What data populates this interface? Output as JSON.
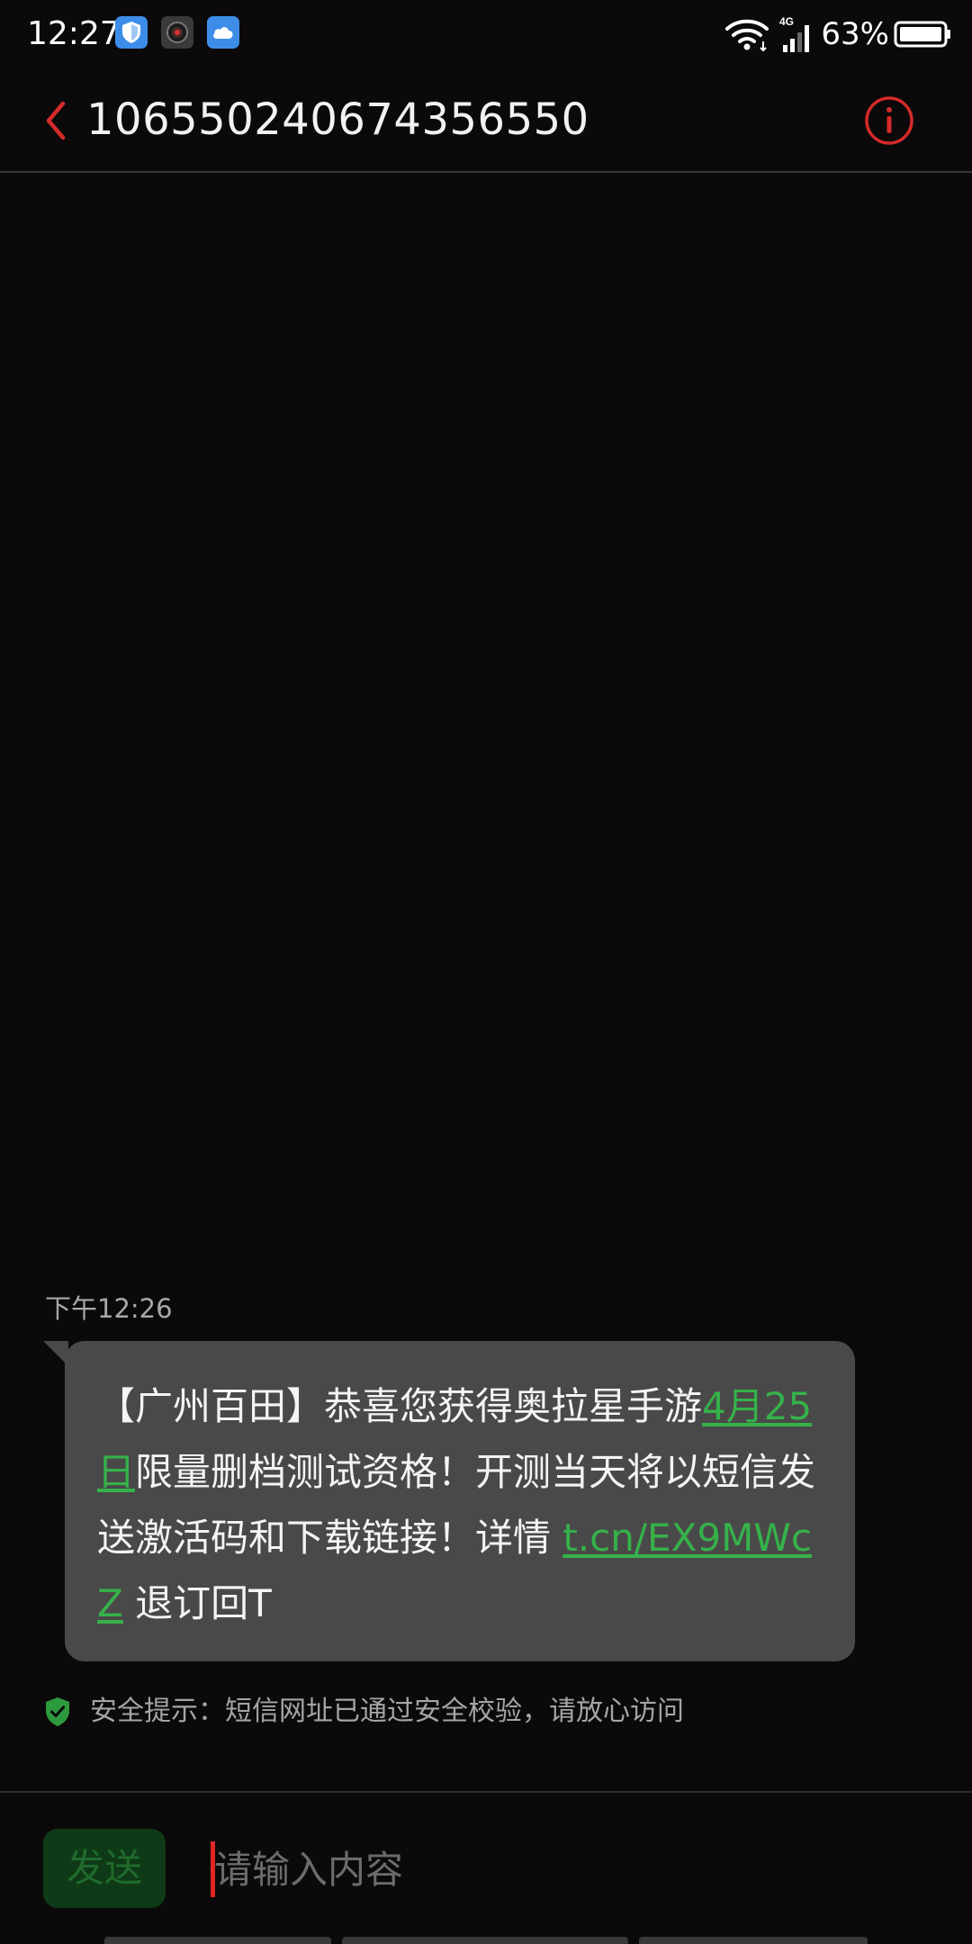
{
  "status_bar": {
    "time": "12:27",
    "network": "4G",
    "battery": "63%",
    "icons": [
      "shield-icon",
      "camera-icon",
      "cloud-icon",
      "wifi-icon",
      "signal-icon",
      "battery-icon"
    ]
  },
  "header": {
    "title": "1065502406743565​50",
    "back_icon": "chevron-left-icon",
    "info_icon": "info-icon"
  },
  "conversation": {
    "messages": [
      {
        "time": "下午12:26",
        "segments": [
          {
            "text": "【广州百田】恭喜您获得奥拉星手游",
            "link": false
          },
          {
            "text": "4月25日",
            "link": true
          },
          {
            "text": "限量删档测试资格！开测当天将以短信发送激活码和下载链接！详情 ",
            "link": false
          },
          {
            "text": "t.cn/EX9MWcZ",
            "link": true
          },
          {
            "text": " 退订回T",
            "link": false
          }
        ]
      }
    ],
    "security_tip": "安全提示：短信网址已通过安全校验，请放心访问"
  },
  "composer": {
    "send_label": "发送",
    "placeholder": "请输入内容"
  },
  "colors": {
    "accent_red": "#d42a2a",
    "link_green": "#35b24a",
    "bubble": "#4a4949",
    "background": "#0b0909"
  }
}
